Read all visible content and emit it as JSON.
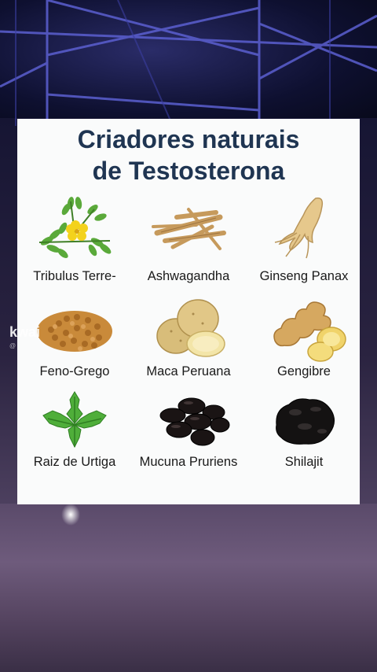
{
  "card": {
    "title_line1": "Criadores naturais",
    "title_line2": "de Testosterona"
  },
  "items": [
    {
      "label": "Tribulus Terre-",
      "icon": "tribulus-icon"
    },
    {
      "label": "Ashwagandha",
      "icon": "ashwagandha-root-icon"
    },
    {
      "label": "Ginseng Panax",
      "icon": "ginseng-root-icon"
    },
    {
      "label": "Feno-Grego",
      "icon": "fenugreek-seeds-icon"
    },
    {
      "label": "Maca Peruana",
      "icon": "maca-root-icon"
    },
    {
      "label": "Gengibre",
      "icon": "ginger-icon"
    },
    {
      "label": "Raiz de Urtiga",
      "icon": "nettle-leaf-icon"
    },
    {
      "label": "Mucuna Pruriens",
      "icon": "mucuna-beans-icon"
    },
    {
      "label": "Shilajit",
      "icon": "shilajit-icon"
    }
  ],
  "watermark": {
    "brand": "kwai",
    "handle": "@ "
  },
  "colors": {
    "title": "#1f3552",
    "card_bg": "#fafbfb",
    "label": "#1a1a1a"
  }
}
